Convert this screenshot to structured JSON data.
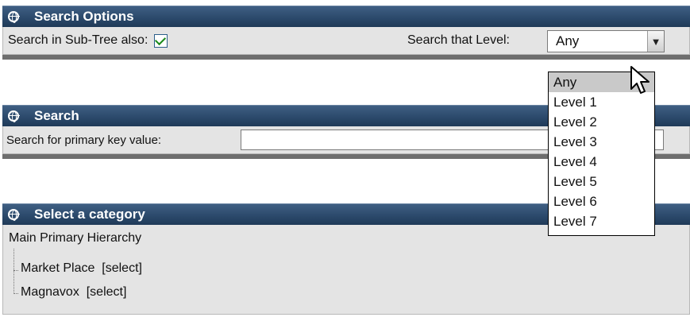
{
  "search_options": {
    "title": "Search Options",
    "subtree_label": "Search in Sub-Tree also:",
    "subtree_checked": true,
    "level_label": "Search that Level:",
    "level_selected": "Any",
    "level_options": [
      "Any",
      "Level 1",
      "Level 2",
      "Level 3",
      "Level 4",
      "Level 5",
      "Level 6",
      "Level 7"
    ]
  },
  "search": {
    "title": "Search",
    "pk_label": "Search for primary key value:",
    "pk_value": ""
  },
  "category": {
    "title": "Select a category",
    "root": "Main Primary Hierarchy",
    "items": [
      {
        "name": "Market Place",
        "action": "[select]"
      },
      {
        "name": "Magnavox",
        "action": "[select]"
      }
    ]
  },
  "colors": {
    "header": "#2c4a6c",
    "panel_bg": "#e4e4e4",
    "check": "#1a8a1a"
  }
}
